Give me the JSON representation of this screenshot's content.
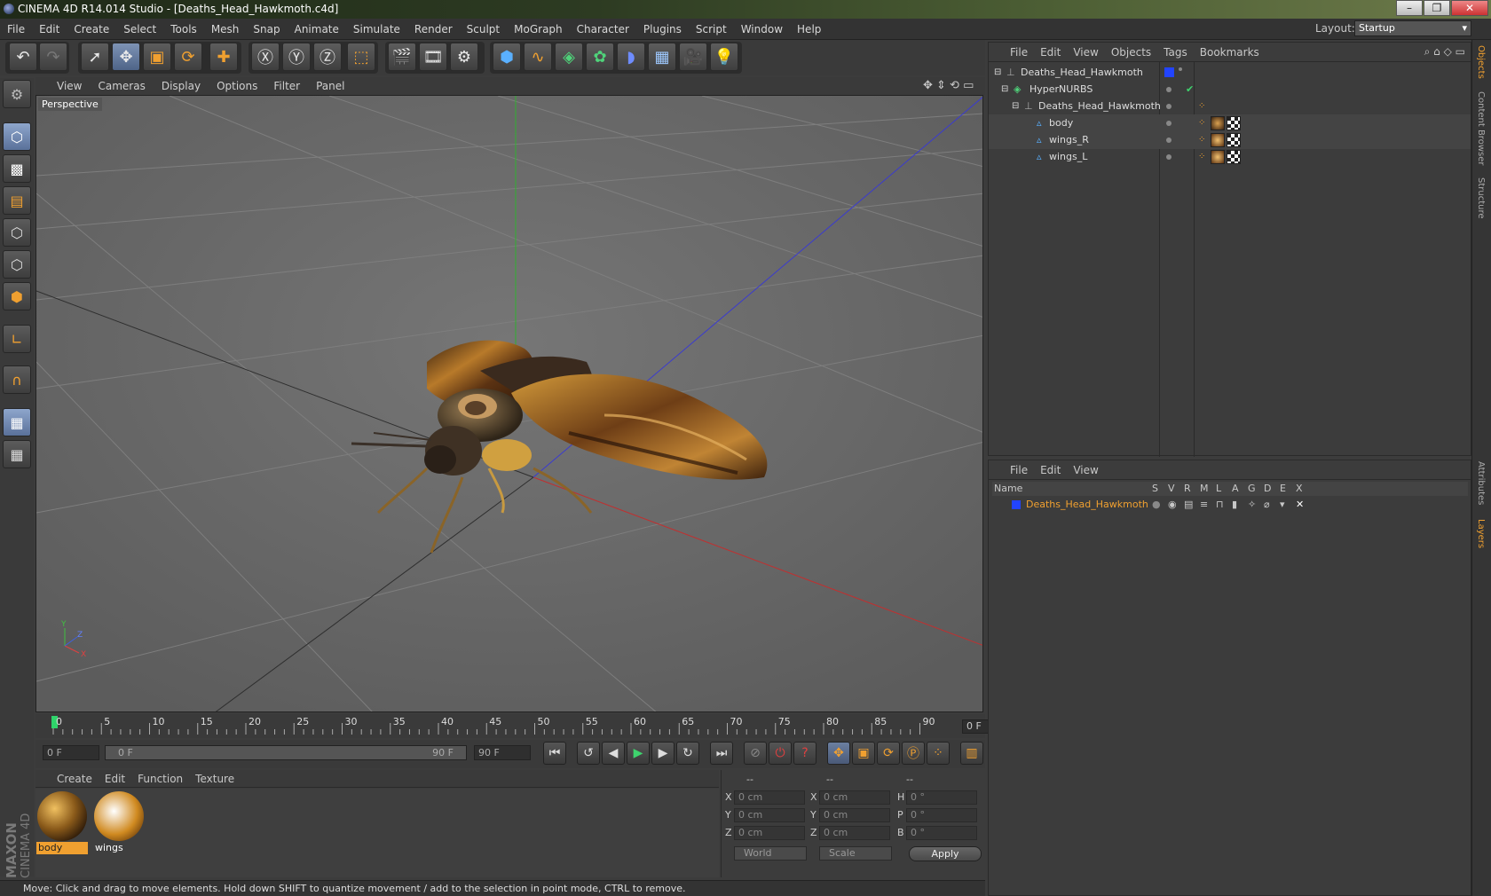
{
  "window": {
    "title": "CINEMA 4D R14.014 Studio - [Deaths_Head_Hawkmoth.c4d]"
  },
  "menu": [
    "File",
    "Edit",
    "Create",
    "Select",
    "Tools",
    "Mesh",
    "Snap",
    "Animate",
    "Simulate",
    "Render",
    "Sculpt",
    "MoGraph",
    "Character",
    "Plugins",
    "Script",
    "Window",
    "Help"
  ],
  "layout": {
    "label": "Layout:",
    "value": "Startup"
  },
  "viewport": {
    "menu": [
      "View",
      "Cameras",
      "Display",
      "Options",
      "Filter",
      "Panel"
    ],
    "camera_label": "Perspective",
    "axis": {
      "x": "X",
      "y": "Y",
      "z": "Z"
    }
  },
  "timeline": {
    "ticks": [
      "0",
      "5",
      "10",
      "15",
      "20",
      "25",
      "30",
      "35",
      "40",
      "45",
      "50",
      "55",
      "60",
      "65",
      "70",
      "75",
      "80",
      "85",
      "90"
    ],
    "current_frame": "0 F",
    "start_field": "0 F",
    "range_start": "0 F",
    "range_end": "90 F",
    "end_field": "90 F"
  },
  "materials": {
    "menu": [
      "Create",
      "Edit",
      "Function",
      "Texture"
    ],
    "items": [
      {
        "label": "body"
      },
      {
        "label": "wings"
      }
    ]
  },
  "coordinates": {
    "headers": [
      "--",
      "--",
      "--"
    ],
    "rows": [
      {
        "l1": "X",
        "v1": "0 cm",
        "l2": "X",
        "v2": "0 cm",
        "l3": "H",
        "v3": "0 °"
      },
      {
        "l1": "Y",
        "v1": "0 cm",
        "l2": "Y",
        "v2": "0 cm",
        "l3": "P",
        "v3": "0 °"
      },
      {
        "l1": "Z",
        "v1": "0 cm",
        "l2": "Z",
        "v2": "0 cm",
        "l3": "B",
        "v3": "0 °"
      }
    ],
    "mode": "World",
    "scale": "Scale",
    "apply": "Apply"
  },
  "status": "Move: Click and drag to move elements. Hold down SHIFT to quantize movement / add to the selection in point mode, CTRL to remove.",
  "object_manager": {
    "menu": [
      "File",
      "Edit",
      "View",
      "Objects",
      "Tags",
      "Bookmarks"
    ],
    "objects": [
      {
        "name": "Deaths_Head_Hawkmoth"
      },
      {
        "name": "HyperNURBS"
      },
      {
        "name": "Deaths_Head_Hawkmoth"
      },
      {
        "name": "body"
      },
      {
        "name": "wings_R"
      },
      {
        "name": "wings_L"
      }
    ]
  },
  "layer_manager": {
    "menu": [
      "File",
      "Edit",
      "View"
    ],
    "columns": {
      "name": "Name",
      "flags": [
        "S",
        "V",
        "R",
        "M",
        "L",
        "A",
        "G",
        "D",
        "E",
        "X"
      ]
    },
    "layers": [
      {
        "name": "Deaths_Head_Hawkmoth",
        "color": "#2244ff"
      }
    ]
  },
  "right_tabs": [
    "Objects",
    "Content Browser",
    "Structure",
    "Attributes",
    "Layers"
  ],
  "branding": {
    "maxon": "MAXON",
    "product": "CINEMA 4D"
  },
  "colors": {
    "accent": "#f0a030",
    "selected_text": "#f0a030",
    "layer_blue": "#2244ff"
  }
}
